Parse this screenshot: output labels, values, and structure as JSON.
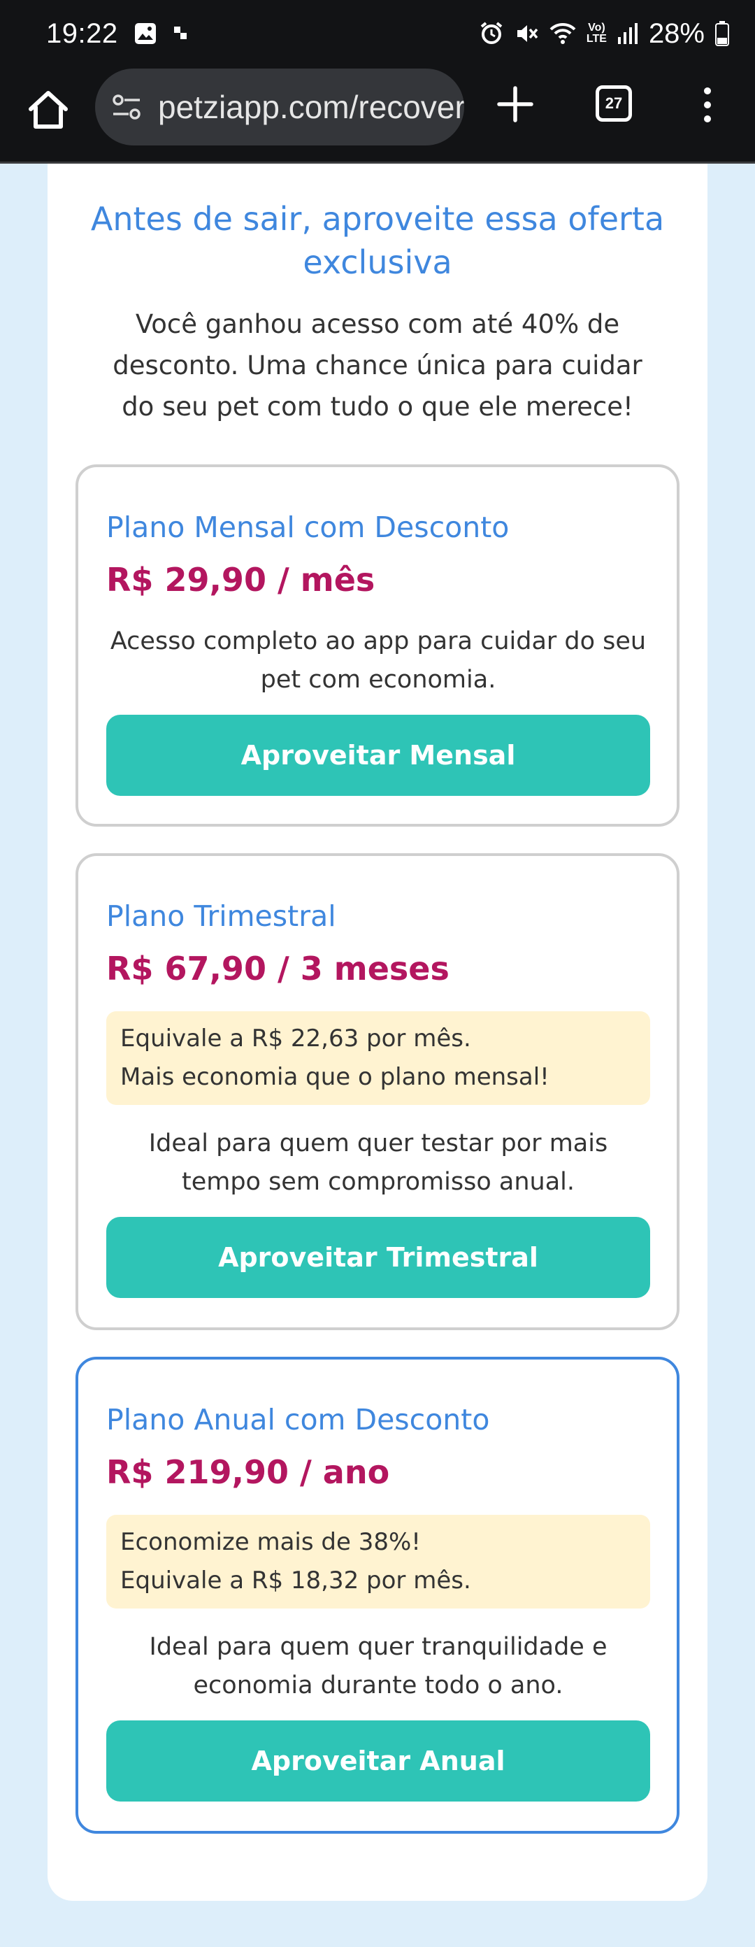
{
  "status_bar": {
    "time": "19:22",
    "battery": "28%",
    "lte_top": "Vo)",
    "lte_bottom": "LTE"
  },
  "browser": {
    "url": "petziapp.com/recovery",
    "tab_count": "27"
  },
  "page": {
    "headline": "Antes de sair, aproveite essa oferta exclusiva",
    "lead": "Você ganhou acesso com até 40% de desconto. Uma chance única para cuidar do seu pet com tudo o que ele merece!",
    "plans": [
      {
        "title": "Plano Mensal com Desconto",
        "price": "R$ 29,90 / mês",
        "description": "Acesso completo ao app para cuidar do seu pet com economia.",
        "button": "Aproveitar Mensal"
      },
      {
        "title": "Plano Trimestral",
        "price": "R$ 67,90 / 3 meses",
        "note_line1": "Equivale a R$ 22,63 por mês.",
        "note_line2": "Mais economia que o plano mensal!",
        "description": "Ideal para quem quer testar por mais tempo sem compromisso anual.",
        "button": "Aproveitar Trimestral"
      },
      {
        "title": "Plano Anual com Desconto",
        "price": "R$ 219,90 / ano",
        "note_line1": "Economize mais de 38%!",
        "note_line2": "Equivale a R$ 18,32 por mês.",
        "description": "Ideal para quem quer tranquilidade e economia durante todo o ano.",
        "button": "Aproveitar Anual"
      }
    ]
  },
  "colors": {
    "accent_blue": "#3f87de",
    "price_magenta": "#b3165f",
    "button_teal": "#2ec4b6",
    "note_yellow": "#fff3d1",
    "page_background": "#ddeefa"
  },
  "icons": [
    "gallery-icon",
    "notification-dot-icon",
    "alarm-icon",
    "mute-icon",
    "wifi-icon",
    "signal-icon",
    "battery-icon",
    "home-icon",
    "site-settings-icon",
    "new-tab-icon",
    "tab-switcher-icon",
    "more-menu-icon"
  ]
}
